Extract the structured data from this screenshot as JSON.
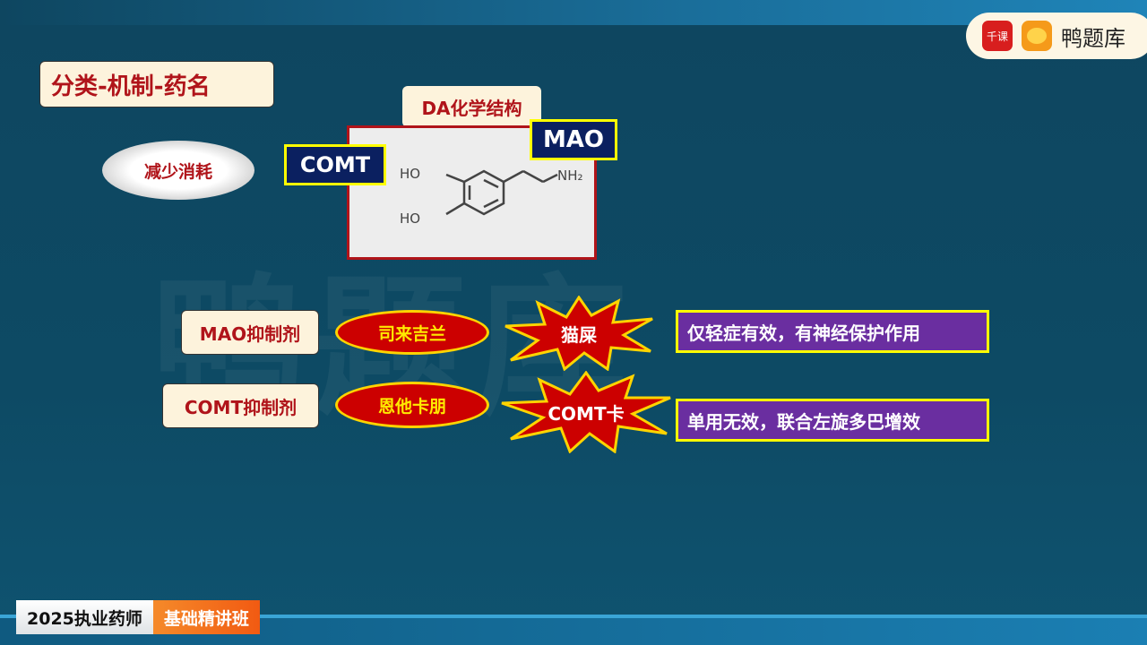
{
  "brand": {
    "qianke": "千课",
    "name": "鸭题库",
    "watermark": "鸭题库"
  },
  "title": "分类-机制-药名",
  "structure": {
    "label": "DA化学结构",
    "comt": "COMT",
    "mao": "MAO",
    "ho1": "HO",
    "ho2": "HO",
    "nh2": "NH₂"
  },
  "mechanism": "减少消耗",
  "rows": [
    {
      "class": "MAO抑制剂",
      "drug": "司来吉兰",
      "mnemonic": "猫屎",
      "note": "仅轻症有效，有神经保护作用"
    },
    {
      "class": "COMT抑制剂",
      "drug": "恩他卡朋",
      "mnemonic": "COMT卡",
      "note": "单用无效，联合左旋多巴增效"
    }
  ],
  "footer": {
    "course": "2025执业药师",
    "series": "基础精讲班"
  },
  "colors": {
    "accent_red": "#cc0000",
    "purple": "#6a2ea0",
    "navy": "#0b2060",
    "highlight": "#ffff00"
  }
}
